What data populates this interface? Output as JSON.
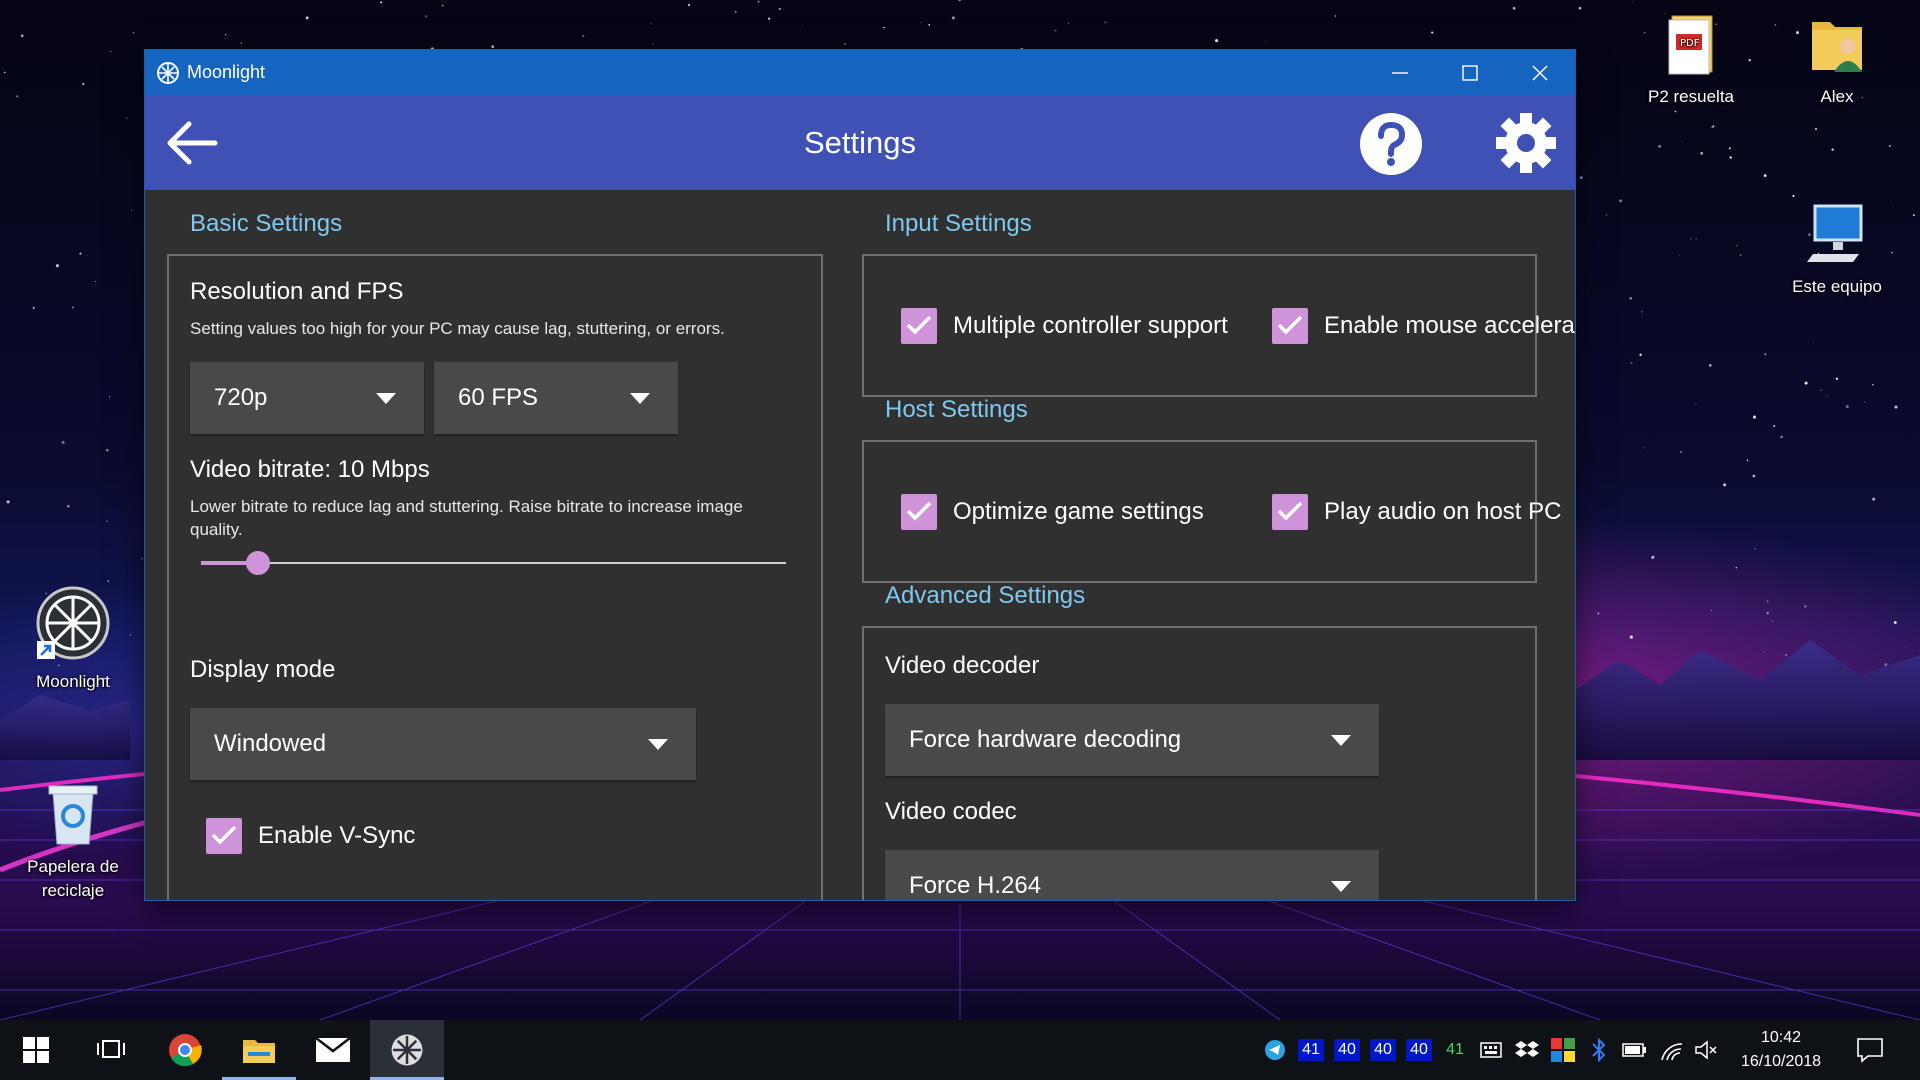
{
  "desktop": {
    "icons": [
      {
        "label": "P2 resuelta",
        "icon": "pdf-file-icon"
      },
      {
        "label": "Alex",
        "icon": "user-folder-icon"
      },
      {
        "label": "Este equipo",
        "icon": "computer-icon"
      },
      {
        "label": "Moonlight",
        "icon": "moonlight-shortcut-icon"
      },
      {
        "label": "Papelera de reciclaje",
        "icon": "recycle-bin-icon"
      }
    ]
  },
  "window": {
    "title": "Moonlight",
    "app_bar_title": "Settings"
  },
  "basic": {
    "section_title": "Basic Settings",
    "res_fps_title": "Resolution and FPS",
    "res_fps_hint": "Setting values too high for your PC may cause lag, stuttering, or errors.",
    "resolution": "720p",
    "fps": "60 FPS",
    "bitrate_title": "Video bitrate: 10 Mbps",
    "bitrate_hint": "Lower bitrate to reduce lag and stuttering. Raise bitrate to increase image quality.",
    "bitrate_slider_fraction": 0.08,
    "display_mode_title": "Display mode",
    "display_mode": "Windowed",
    "vsync_label": "Enable V-Sync",
    "vsync_checked": true
  },
  "input": {
    "section_title": "Input Settings",
    "multi_controller_label": "Multiple controller support",
    "mouse_accel_label": "Enable mouse accelerat"
  },
  "host": {
    "section_title": "Host Settings",
    "optimize_label": "Optimize game settings",
    "audio_label": "Play audio on host PC"
  },
  "advanced": {
    "section_title": "Advanced Settings",
    "decoder_title": "Video decoder",
    "decoder_value": "Force hardware decoding",
    "codec_title": "Video codec",
    "codec_value": "Force H.264"
  },
  "taskbar": {
    "tray_numbers": [
      "41",
      "40",
      "40",
      "40",
      "41"
    ],
    "time": "10:42",
    "date": "16/10/2018"
  },
  "colors": {
    "title_bar": "#1565c0",
    "app_bar": "#3f51b5",
    "section_title": "#7fc8f0",
    "checkbox": "#ce93d8",
    "panel": "#303030"
  }
}
